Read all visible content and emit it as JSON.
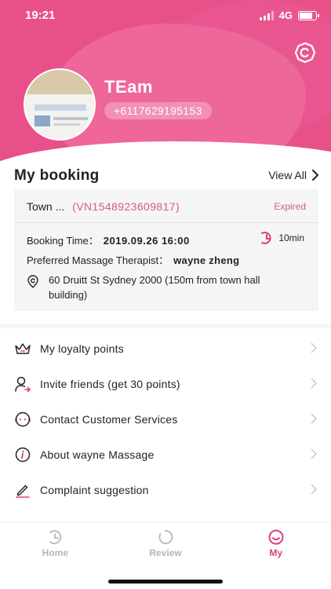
{
  "status_bar": {
    "time": "19:21",
    "network": "4G"
  },
  "profile": {
    "name": "TEam",
    "phone": "+6117629195153"
  },
  "booking": {
    "title": "My booking",
    "view_all": "View All",
    "card": {
      "location": "Town ...",
      "code": "(VN1548923609817)",
      "status": "Expired",
      "time_label": "Booking Time：",
      "time_value": "2019.09.26 16:00",
      "duration": "10min",
      "therapist_label": "Preferred Massage Therapist：",
      "therapist_value": "wayne zheng",
      "address": "60 Druitt St Sydney 2000 (150m from town hall building)"
    }
  },
  "menu": {
    "items": [
      {
        "label": "My loyalty points",
        "icon": "crown-icon"
      },
      {
        "label": "Invite friends (get 30 points)",
        "icon": "invite-user-icon"
      },
      {
        "label": "Contact Customer Services",
        "icon": "customer-service-icon"
      },
      {
        "label": "About wayne Massage",
        "icon": "info-icon"
      },
      {
        "label": "Complaint suggestion",
        "icon": "pencil-icon"
      }
    ]
  },
  "tabs": [
    {
      "label": "Home",
      "icon": "home-clock-icon",
      "active": false
    },
    {
      "label": "Review",
      "icon": "review-ring-icon",
      "active": false
    },
    {
      "label": "My",
      "icon": "profile-face-icon",
      "active": true
    }
  ],
  "colors": {
    "brand": "#e8508a",
    "accent_text": "#d25a8c",
    "active_tab": "#d9407f"
  }
}
